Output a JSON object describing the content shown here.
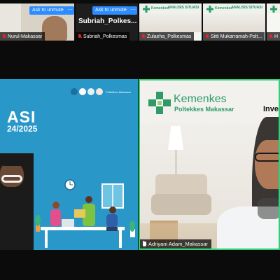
{
  "strip": {
    "tiles": [
      {
        "name": "Nurul-Makassar",
        "unmute_label": "Ask to unmute",
        "more_label": "···"
      },
      {
        "name": "Subriah_Polkesmas",
        "display_name": "Subriah_Polkes...",
        "unmute_label": "Ask to unmute",
        "more_label": "···"
      },
      {
        "name": "Zulaeha_Polkesmas",
        "slide_title": "ANALISIS SITUASI",
        "logo_text": "Kemenkes"
      },
      {
        "name": "Sitti Mukarramah-Polt...",
        "slide_title": "ANALISIS SITUASI",
        "logo_text": "Kemenkes"
      },
      {
        "name": "H"
      }
    ]
  },
  "left_panel": {
    "slide_title": "ASI",
    "slide_date": "24/2025",
    "logo_caption": "Poltekkes Makassar"
  },
  "right_panel": {
    "logo_name": "Kemenkes",
    "logo_sub": "Poltekkes Makassar",
    "heading": "Inve",
    "speaker_name": "Adriyani Adam_Makassar"
  },
  "icons": {
    "mic_muted": "mic-muted-icon",
    "more": "more-options-icon",
    "logo": "kemenkes-cross-logo"
  },
  "colors": {
    "accent_blue": "#2d8cff",
    "active_speaker_border": "#2fd07a",
    "muted_red": "#e02828",
    "kemenkes_green": "#2e9b68"
  }
}
